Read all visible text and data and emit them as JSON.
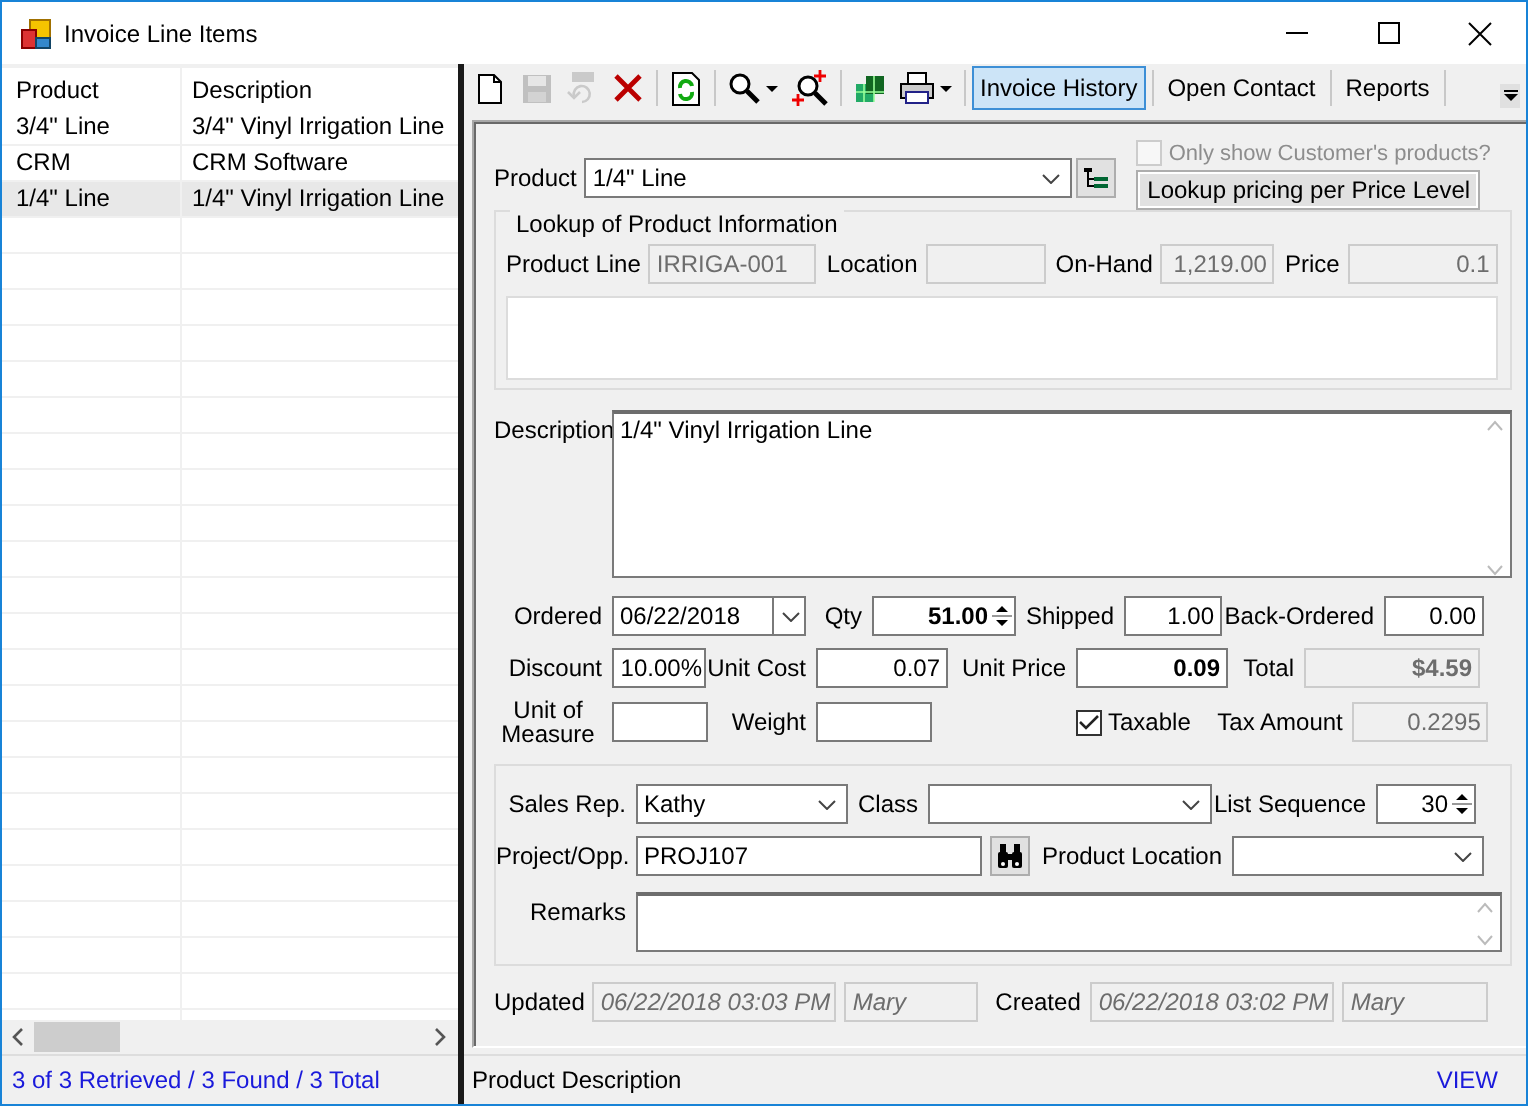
{
  "window": {
    "title": "Invoice Line Items"
  },
  "list": {
    "columns": [
      "Product",
      "Description"
    ],
    "rows": [
      {
        "product": "3/4\" Line",
        "description": "3/4\"  Vinyl Irrigation Line",
        "selected": false
      },
      {
        "product": "CRM",
        "description": "CRM Software",
        "selected": false
      },
      {
        "product": "1/4\" Line",
        "description": "1/4\"  Vinyl Irrigation Line",
        "selected": true
      }
    ],
    "status": "3 of 3 Retrieved / 3 Found / 3 Total"
  },
  "toolbar": {
    "icons": [
      {
        "kind": "new",
        "disabled": false
      },
      {
        "kind": "save",
        "disabled": true
      },
      {
        "kind": "undo",
        "disabled": true
      },
      {
        "kind": "delete",
        "disabled": false
      },
      {
        "kind": "separator"
      },
      {
        "kind": "refresh",
        "disabled": false
      },
      {
        "kind": "separator"
      },
      {
        "kind": "search",
        "disabled": false,
        "dropdown": true
      },
      {
        "kind": "search-add",
        "disabled": false
      },
      {
        "kind": "separator"
      },
      {
        "kind": "cubes",
        "disabled": false
      },
      {
        "kind": "print",
        "disabled": false,
        "dropdown": true
      },
      {
        "kind": "separator"
      }
    ],
    "text_buttons": [
      {
        "label": "Invoice History",
        "selected": true
      },
      {
        "label": "Open Contact",
        "selected": false
      },
      {
        "label": "Reports",
        "selected": false
      }
    ]
  },
  "form": {
    "product": {
      "label": "Product",
      "value": "1/4\" Line"
    },
    "only_customer_products": {
      "label": "Only show Customer's products?",
      "checked": false,
      "disabled": true
    },
    "lookup_button": "Lookup pricing per Price Level",
    "lookup_group": {
      "title": "Lookup of Product Information",
      "product_line": {
        "label": "Product Line",
        "value": "IRRIGA-001"
      },
      "location": {
        "label": "Location"
      },
      "on_hand": {
        "label": "On-Hand",
        "value": "1,219.00"
      },
      "price": {
        "label": "Price",
        "value": "0.1"
      }
    },
    "description": {
      "label": "Description",
      "value": "1/4\"  Vinyl Irrigation Line"
    },
    "ordered": {
      "label": "Ordered",
      "value": "06/22/2018"
    },
    "qty": {
      "label": "Qty",
      "value": "51.00"
    },
    "shipped": {
      "label": "Shipped",
      "value": "1.00"
    },
    "back_ordered": {
      "label": "Back-Ordered",
      "value": "0.00"
    },
    "discount": {
      "label": "Discount",
      "value": "10.00%"
    },
    "unit_cost": {
      "label": "Unit Cost",
      "value": "0.07"
    },
    "unit_price": {
      "label": "Unit Price",
      "value": "0.09"
    },
    "total": {
      "label": "Total",
      "value": "$4.59"
    },
    "unit_of_measure": {
      "label": "Unit of Measure"
    },
    "weight": {
      "label": "Weight"
    },
    "taxable": {
      "label": "Taxable",
      "checked": true
    },
    "tax_amount": {
      "label": "Tax Amount",
      "value": "0.2295"
    },
    "sales_rep": {
      "label": "Sales Rep.",
      "value": "Kathy"
    },
    "class": {
      "label": "Class"
    },
    "list_sequence": {
      "label": "List Sequence",
      "value": "30"
    },
    "project": {
      "label": "Project/Opp.",
      "value": "PROJ107"
    },
    "product_location": {
      "label": "Product Location"
    },
    "remarks": {
      "label": "Remarks"
    },
    "updated": {
      "label": "Updated",
      "value": "06/22/2018  03:03 PM",
      "user": "Mary"
    },
    "created": {
      "label": "Created",
      "value": "06/22/2018  03:02 PM",
      "user": "Mary"
    }
  },
  "status": {
    "text": "Product Description",
    "mode": "VIEW"
  }
}
